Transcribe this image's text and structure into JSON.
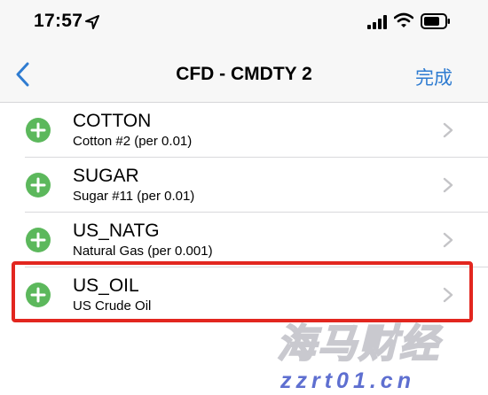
{
  "status_bar": {
    "time": "17:57",
    "location_icon": "location-arrow-icon",
    "signal_icon": "cellular-signal-icon",
    "wifi_icon": "wifi-icon",
    "battery_icon": "battery-icon"
  },
  "nav": {
    "back_icon": "chevron-left-icon",
    "title": "CFD - CMDTY 2",
    "done_label": "完成"
  },
  "colors": {
    "accent": "#2f7cd1",
    "add_green": "#5cb85c",
    "highlight": "#e2261f"
  },
  "items": [
    {
      "title": "COTTON",
      "subtitle": "Cotton #2 (per 0.01)"
    },
    {
      "title": "SUGAR",
      "subtitle": "Sugar #11 (per 0.01)"
    },
    {
      "title": "US_NATG",
      "subtitle": "Natural Gas (per 0.001)"
    },
    {
      "title": "US_OIL",
      "subtitle": "US Crude Oil"
    }
  ],
  "watermark": {
    "text": "海马财经",
    "url": "zzrt01.cn"
  }
}
